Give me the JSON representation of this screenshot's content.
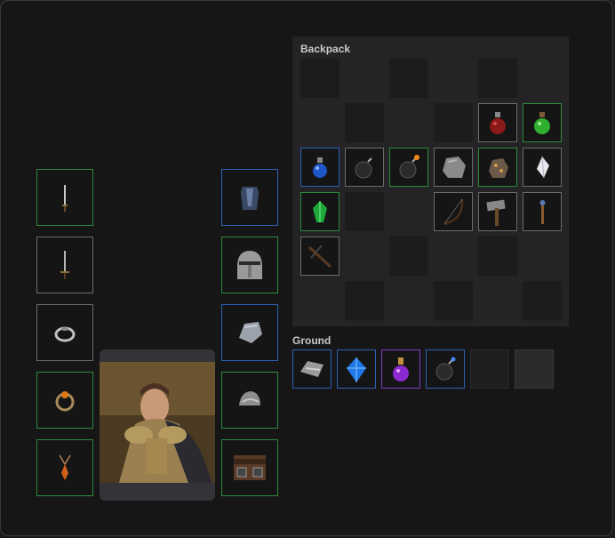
{
  "backpack": {
    "title": "Backpack"
  },
  "ground": {
    "title": "Ground"
  },
  "equipment": {
    "left": [
      {
        "name": "dagger-icon",
        "rarity": "green"
      },
      {
        "name": "sword-icon",
        "rarity": "gray"
      },
      {
        "name": "ring-icon",
        "rarity": "gray"
      },
      {
        "name": "amber-ring-icon",
        "rarity": "green"
      },
      {
        "name": "amulet-icon",
        "rarity": "green"
      }
    ],
    "right": [
      {
        "name": "chest-armor-icon",
        "rarity": "blue"
      },
      {
        "name": "helmet-icon",
        "rarity": "green"
      },
      {
        "name": "gauntlet-icon",
        "rarity": "blue"
      },
      {
        "name": "shoulder-armor-icon",
        "rarity": "green"
      },
      {
        "name": "belt-icon",
        "rarity": "green"
      }
    ]
  },
  "backpack_items": [
    {
      "row": 1,
      "col": 4,
      "name": "red-potion-icon",
      "rarity": "gray"
    },
    {
      "row": 1,
      "col": 5,
      "name": "green-potion-icon",
      "rarity": "green"
    },
    {
      "row": 2,
      "col": 0,
      "name": "blue-potion-icon",
      "rarity": "blue"
    },
    {
      "row": 2,
      "col": 1,
      "name": "bomb-icon",
      "rarity": "gray"
    },
    {
      "row": 2,
      "col": 2,
      "name": "lit-bomb-icon",
      "rarity": "green"
    },
    {
      "row": 2,
      "col": 3,
      "name": "stone-icon",
      "rarity": "gray"
    },
    {
      "row": 2,
      "col": 4,
      "name": "ore-icon",
      "rarity": "green"
    },
    {
      "row": 2,
      "col": 5,
      "name": "crystal-icon",
      "rarity": "gray"
    },
    {
      "row": 3,
      "col": 0,
      "name": "emerald-icon",
      "rarity": "green"
    },
    {
      "row": 3,
      "col": 3,
      "name": "bow-icon",
      "rarity": "gray"
    },
    {
      "row": 3,
      "col": 4,
      "name": "hammer-icon",
      "rarity": "gray"
    },
    {
      "row": 3,
      "col": 5,
      "name": "wand-icon",
      "rarity": "gray"
    },
    {
      "row": 4,
      "col": 0,
      "name": "crossbow-icon",
      "rarity": "gray"
    }
  ],
  "ground_items": [
    {
      "name": "iron-ingot-icon",
      "rarity": "blue"
    },
    {
      "name": "sapphire-icon",
      "rarity": "blue"
    },
    {
      "name": "purple-potion-icon",
      "rarity": "purple"
    },
    {
      "name": "bomb-blue-icon",
      "rarity": "blue"
    },
    {
      "name": "empty",
      "rarity": "dark"
    },
    {
      "name": "empty",
      "rarity": "darkgray"
    }
  ],
  "colors": {
    "green": "#2f8a3b",
    "blue": "#2f5fb5",
    "gray": "#6b6b6b",
    "purple": "#7a3cc0"
  }
}
